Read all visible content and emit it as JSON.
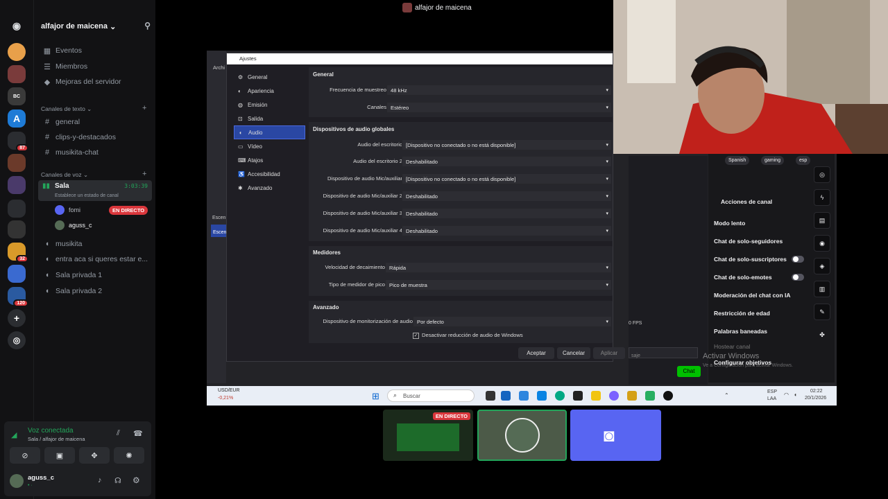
{
  "top_bar": {
    "title": "alfajor de maicena"
  },
  "server": {
    "name": "alfajor de maicena"
  },
  "channels": {
    "top_items": [
      "Eventos",
      "Miembros",
      "Mejoras del servidor"
    ],
    "text_category": "Canales de texto",
    "text": [
      "general",
      "clips-y-destacados",
      "musikita-chat"
    ],
    "voice_category": "Canales de voz",
    "active_voice": {
      "name": "Sala",
      "timer": "3:03:39",
      "status": "Establece un estado de canal"
    },
    "voice_users": [
      {
        "name": "fomi",
        "badge": "EN DIRECTO"
      },
      {
        "name": "aguss_c"
      }
    ],
    "voice_other": [
      "musikita",
      "entra aca si queres estar e...",
      "Sala privada 1",
      "Sala privada 2"
    ]
  },
  "server_badges": [
    "87",
    "32",
    "120"
  ],
  "voice_panel": {
    "status": "Voz conectada",
    "location": "Sala / alfajor de maicena"
  },
  "user_panel": {
    "username": "aguss_c",
    "sub": "•  ·"
  },
  "obs": {
    "window_left": "Archi",
    "title": "Ajustes",
    "nav": [
      "General",
      "Apariencia",
      "Emisión",
      "Salida",
      "Audio",
      "Vídeo",
      "Atajos",
      "Accesibilidad",
      "Avanzado"
    ],
    "sections": {
      "general": "General",
      "devices": "Dispositivos de audio globales",
      "meters": "Medidores",
      "advanced": "Avanzado"
    },
    "rows": [
      {
        "label": "Frecuencia de muestreo",
        "value": "48 kHz"
      },
      {
        "label": "Canales",
        "value": "Estéreo"
      },
      {
        "label": "Audio del escritorio",
        "value": "[Dispositivo no conectado o no está disponible]"
      },
      {
        "label": "Audio del escritorio 2",
        "value": "Deshabilitado"
      },
      {
        "label": "Dispositivo de audio Mic/auxiliar",
        "value": "[Dispositivo no conectado o no está disponible]"
      },
      {
        "label": "Dispositivo de audio Mic/auxiliar 2",
        "value": "Deshabilitado"
      },
      {
        "label": "Dispositivo de audio Mic/auxiliar 3",
        "value": "Deshabilitado"
      },
      {
        "label": "Dispositivo de audio Mic/auxiliar 4",
        "value": "Deshabilitado"
      },
      {
        "label": "Velocidad de decaimiento",
        "value": "Rápida"
      },
      {
        "label": "Tipo de medidor de pico",
        "value": "Pico de muestra"
      },
      {
        "label": "Dispositivo de monitorización de audio",
        "value": "Por defecto"
      }
    ],
    "checkbox": "Desactivar reducción de audio de Windows",
    "buttons": {
      "accept": "Aceptar",
      "cancel": "Cancelar",
      "apply": "Aplicar"
    },
    "bg_labels": {
      "scenes": "Escen",
      "scene_item": "Escen",
      "fps": "0 FPS"
    }
  },
  "twitch": {
    "tags": [
      "Spanish",
      "gaming",
      "esp"
    ],
    "actions_title": "Acciones de canal",
    "items": [
      "Modo lento",
      "Chat de solo-seguidores",
      "Chat de solo-suscriptores",
      "Chat de solo-emotes",
      "Moderación del chat con IA",
      "Restricción de edad",
      "Palabras baneadas",
      "Hostear canal",
      "Configurar objetivos"
    ],
    "chat_button": "Chat",
    "message_placeholder": "saje"
  },
  "taskbar": {
    "ticker": "USD/EUR",
    "ticker_change": "-0,21%",
    "search": "Buscar",
    "lang": "ESP",
    "lang2": "LAA",
    "time": "02:22",
    "date": "20/1/2026"
  },
  "watermark": {
    "line1": "Activar Windows",
    "line2": "Ve a Configuración para activar Windows."
  },
  "thumbnails": {
    "live_badge": "EN DIRECTO"
  }
}
